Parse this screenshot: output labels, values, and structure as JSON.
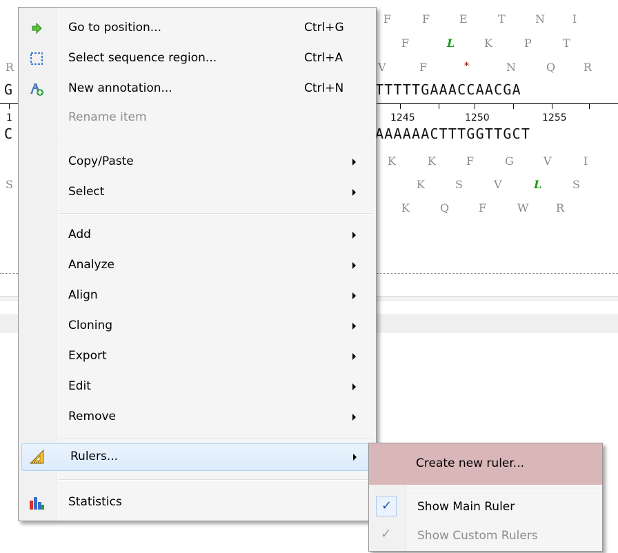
{
  "sequence": {
    "aa_row1": [
      "F",
      "F",
      "E",
      "T",
      "N",
      "I"
    ],
    "aa_row2": [
      "F",
      "L",
      "K",
      "P",
      "T"
    ],
    "aa_row3": [
      "R",
      "V",
      "F",
      "*",
      "N",
      "Q",
      "R"
    ],
    "dna_top_left": "G",
    "dna_top": "TTTTTGAAACCAACGA",
    "ruler_left": "1",
    "ruler_ticks": [
      "1245",
      "1250",
      "1255"
    ],
    "dna_bottom_left": "C",
    "dna_bottom": "AAAAAACTTTGGTTGCT",
    "aa_row4": [
      "K",
      "K",
      "F",
      "G",
      "V",
      "I"
    ],
    "aa_row5_left": "S",
    "aa_row5": [
      "K",
      "S",
      "V",
      "L",
      "S"
    ],
    "aa_row6": [
      "K",
      "Q",
      "F",
      "W",
      "R"
    ]
  },
  "menu": {
    "items": [
      {
        "label": "Go to position...",
        "shortcut": "Ctrl+G",
        "icon": "green-arrow-icon"
      },
      {
        "label": "Select sequence region...",
        "shortcut": "Ctrl+A",
        "icon": "selection-icon"
      },
      {
        "label": "New annotation...",
        "shortcut": "Ctrl+N",
        "icon": "annotation-icon"
      },
      {
        "label": "Rename item",
        "disabled": true
      },
      {
        "label": "Copy/Paste",
        "submenu": true
      },
      {
        "label": "Select",
        "submenu": true
      },
      {
        "label": "Add",
        "submenu": true
      },
      {
        "label": "Analyze",
        "submenu": true
      },
      {
        "label": "Align",
        "submenu": true
      },
      {
        "label": "Cloning",
        "submenu": true
      },
      {
        "label": "Export",
        "submenu": true
      },
      {
        "label": "Edit",
        "submenu": true
      },
      {
        "label": "Remove",
        "submenu": true
      },
      {
        "label": "Rulers...",
        "submenu": true,
        "icon": "ruler-icon"
      },
      {
        "label": "Statistics",
        "icon": "bar-chart-icon"
      }
    ]
  },
  "submenu": {
    "items": [
      {
        "label": "Create new ruler..."
      },
      {
        "label": "Show Main Ruler",
        "checked": true
      },
      {
        "label": "Show Custom Rulers",
        "checked": true,
        "disabled": true
      }
    ],
    "check_glyph": "✓"
  },
  "colors": {
    "hover_accent": "#aecff7",
    "submenu_hover": "#d9b6b8",
    "green_amino": "#1a9a1a",
    "stop_codon": "#8b0000"
  }
}
